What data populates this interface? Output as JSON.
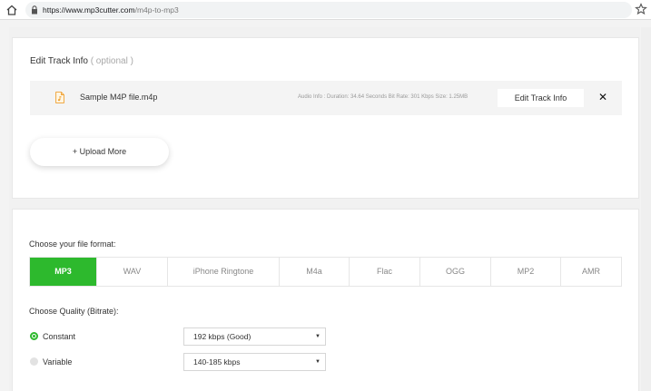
{
  "browser": {
    "url_host": "https://www.mp3cutter.com",
    "url_path": "/m4p-to-mp3"
  },
  "edit_section": {
    "title": "Edit Track Info",
    "optional": "( optional )",
    "file": {
      "name": "Sample M4P file.m4p",
      "audio_info": "Audio Info : Duration: 34.64 Seconds Bit Rate: 301 Kbps Size: 1.25MB",
      "edit_label": "Edit Track Info",
      "remove_label": "✕"
    },
    "upload_more_label": "+ Upload More"
  },
  "format_section": {
    "label": "Choose your file format:",
    "formats": [
      "MP3",
      "WAV",
      "iPhone Ringtone",
      "M4a",
      "Flac",
      "OGG",
      "MP2",
      "AMR"
    ],
    "selected": "MP3"
  },
  "quality_section": {
    "label": "Choose Quality (Bitrate):",
    "options": [
      {
        "label": "Constant",
        "checked": true,
        "value": "192 kbps (Good)"
      },
      {
        "label": "Variable",
        "checked": false,
        "value": "140-185 kbps"
      }
    ]
  },
  "colors": {
    "accent": "#2db92d"
  }
}
